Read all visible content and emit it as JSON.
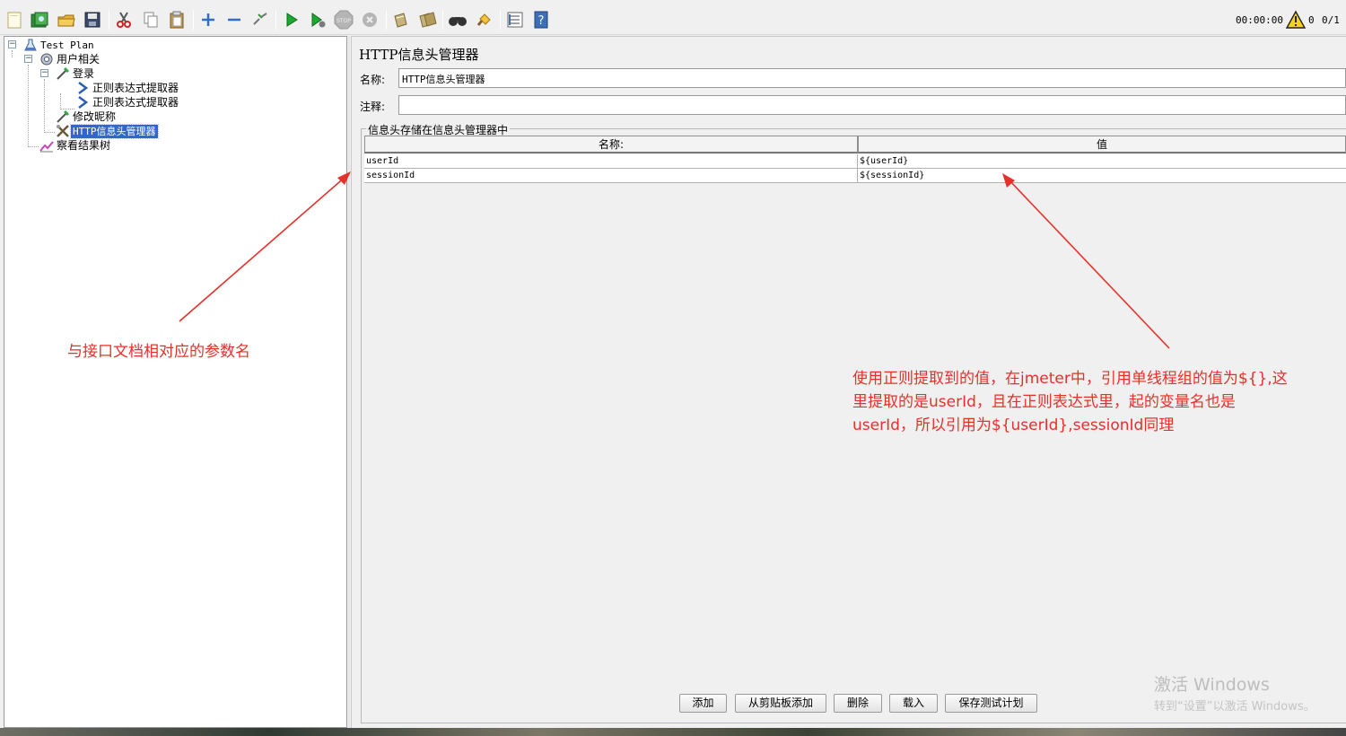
{
  "toolbar": {
    "timer": "00:00:00",
    "warning_count": "0",
    "threads": "0/1",
    "icons": [
      "new-icon",
      "templates-icon",
      "open-icon",
      "save-icon",
      "cut-icon",
      "copy-icon",
      "paste-icon",
      "expand-icon",
      "collapse-icon",
      "toggle-icon",
      "start-icon",
      "start-no-pause-icon",
      "stop-icon",
      "shutdown-icon",
      "clear-icon",
      "clear-all-icon",
      "search-icon",
      "reset-search-icon",
      "function-helper-icon",
      "help-icon"
    ]
  },
  "tree": {
    "items": [
      {
        "label": "Test Plan",
        "icon": "test-plan-icon"
      },
      {
        "label": "用户相关",
        "icon": "thread-group-icon"
      },
      {
        "label": "登录",
        "icon": "http-sampler-icon"
      },
      {
        "label": "正则表达式提取器",
        "icon": "regex-extractor-icon"
      },
      {
        "label": "正则表达式提取器",
        "icon": "regex-extractor-icon"
      },
      {
        "label": "修改昵称",
        "icon": "http-sampler-icon"
      },
      {
        "label": "HTTP信息头管理器",
        "icon": "header-manager-icon"
      },
      {
        "label": "察看结果树",
        "icon": "results-tree-icon"
      }
    ]
  },
  "panel": {
    "title": "HTTP信息头管理器",
    "name_label": "名称:",
    "name_value": "HTTP信息头管理器",
    "comment_label": "注释:",
    "comment_value": "",
    "group_title": "信息头存储在信息头管理器中",
    "table": {
      "headers": [
        "名称:",
        "值"
      ],
      "rows": [
        {
          "name": "userId",
          "value": "${userId}"
        },
        {
          "name": "sessionId",
          "value": "${sessionId}"
        }
      ]
    },
    "buttons": {
      "add": "添加",
      "add_from_clipboard": "从剪贴板添加",
      "delete": "删除",
      "load": "载入",
      "save": "保存测试计划"
    }
  },
  "annotations": {
    "left_note": "与接口文档相对应的参数名",
    "right_note_line1": "使用正则提取到的值，在jmeter中，引用单线程组的值为${},这",
    "right_note_line2": "里提取的是userId，且在正则表达式里，起的变量名也是",
    "right_note_line3": "userId，所以引用为${userId},sessionId同理",
    "color": "#e8302a"
  },
  "watermark": {
    "title": "激活 Windows",
    "subtitle": "转到“设置”以激活 Windows。"
  }
}
